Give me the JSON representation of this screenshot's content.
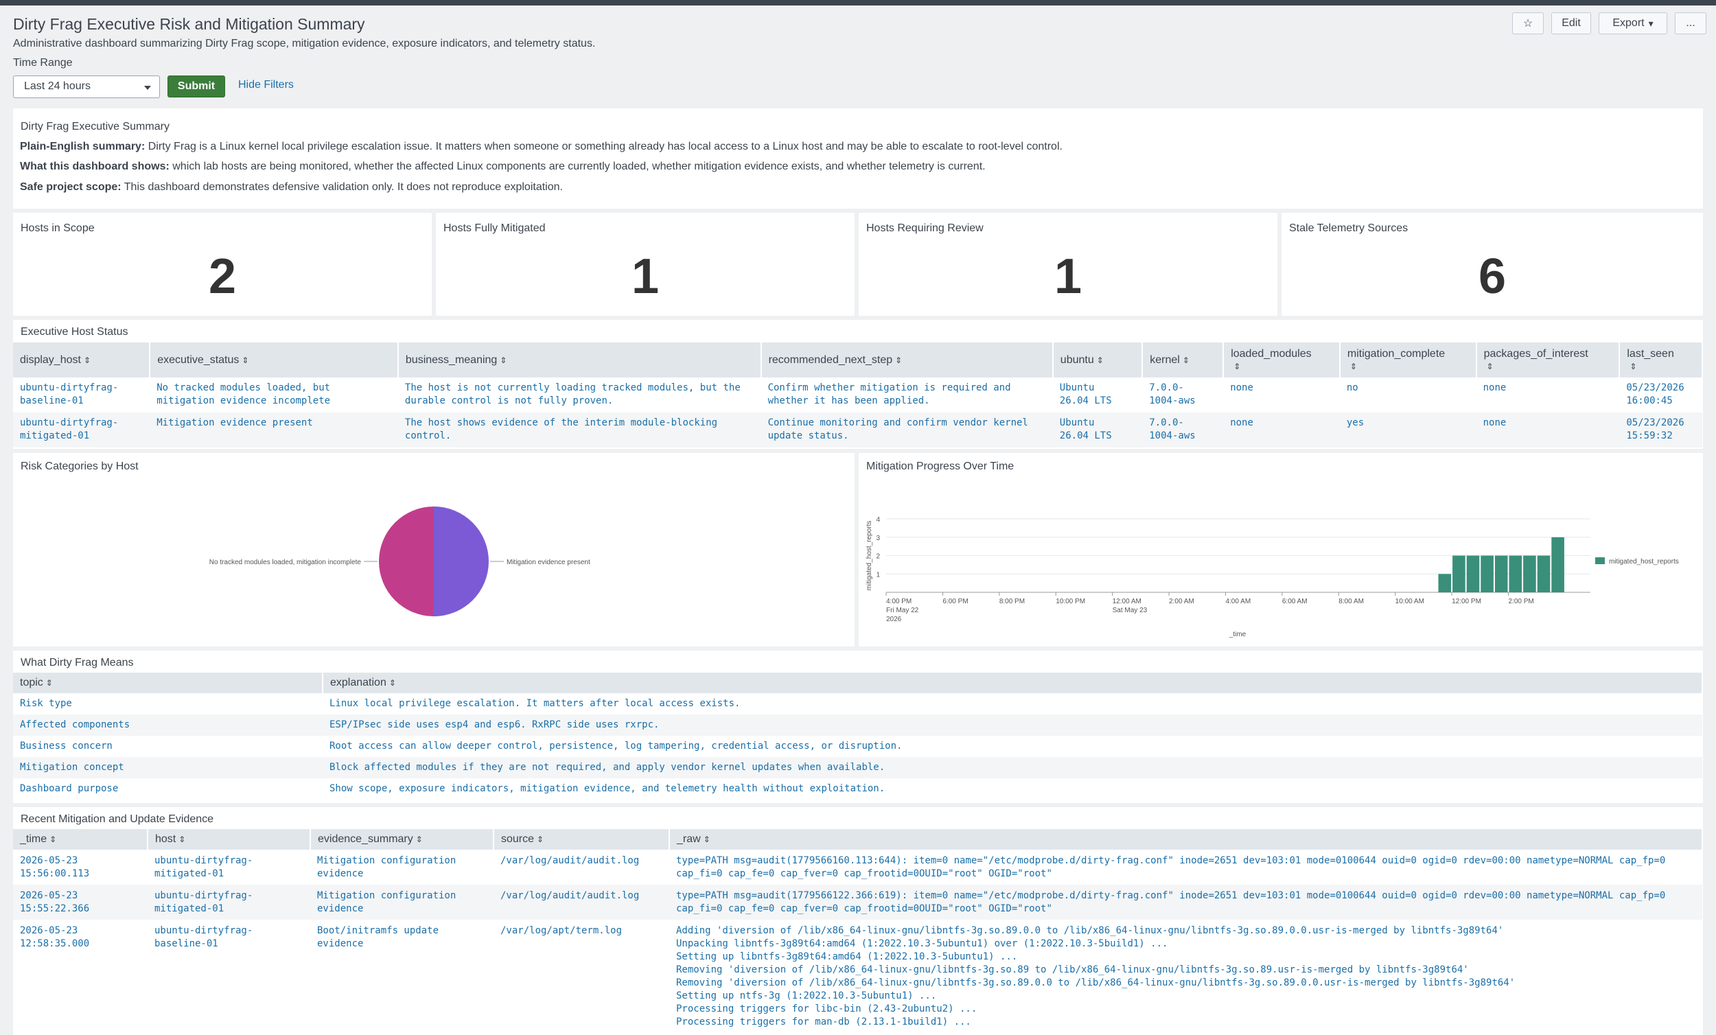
{
  "header": {
    "title": "Dirty Frag Executive Risk and Mitigation Summary",
    "description": "Administrative dashboard summarizing Dirty Frag scope, mitigation evidence, exposure indicators, and telemetry status.",
    "star_icon": "☆",
    "edit_label": "Edit",
    "export_label": "Export",
    "more_label": "..."
  },
  "filters": {
    "time_range_label": "Time Range",
    "time_range_value": "Last 24 hours",
    "submit_label": "Submit",
    "hide_filters_label": "Hide Filters"
  },
  "summary": {
    "title": "Dirty Frag Executive Summary",
    "lines": [
      {
        "bold": "Plain-English summary:",
        "text": " Dirty Frag is a Linux kernel local privilege escalation issue. It matters when someone or something already has local access to a Linux host and may be able to escalate to root-level control."
      },
      {
        "bold": "What this dashboard shows:",
        "text": " which lab hosts are being monitored, whether the affected Linux components are currently loaded, whether mitigation evidence exists, and whether telemetry is current."
      },
      {
        "bold": "Safe project scope:",
        "text": " This dashboard demonstrates defensive validation only. It does not reproduce exploitation."
      }
    ]
  },
  "kpis": [
    {
      "title": "Hosts in Scope",
      "value": "2"
    },
    {
      "title": "Hosts Fully Mitigated",
      "value": "1"
    },
    {
      "title": "Hosts Requiring Review",
      "value": "1"
    },
    {
      "title": "Stale Telemetry Sources",
      "value": "6"
    }
  ],
  "host_status": {
    "title": "Executive Host Status",
    "columns": [
      "display_host",
      "executive_status",
      "business_meaning",
      "recommended_next_step",
      "ubuntu",
      "kernel",
      "loaded_modules",
      "mitigation_complete",
      "packages_of_interest",
      "last_seen"
    ],
    "rows": [
      {
        "display_host": [
          "ubuntu-dirtyfrag-",
          "baseline-01"
        ],
        "executive_status": [
          "No tracked modules loaded, but",
          "mitigation evidence incomplete"
        ],
        "business_meaning": [
          "The host is not currently loading tracked modules, but the",
          "durable control is not fully proven."
        ],
        "recommended_next_step": [
          "Confirm whether mitigation is required and",
          "whether it has been applied."
        ],
        "ubuntu": [
          "Ubuntu",
          "26.04 LTS"
        ],
        "kernel": [
          "7.0.0-",
          "1004-aws"
        ],
        "loaded_modules": [
          "none"
        ],
        "mitigation_complete": [
          "no"
        ],
        "packages_of_interest": [
          "none"
        ],
        "last_seen": [
          "05/23/2026",
          "16:00:45"
        ]
      },
      {
        "display_host": [
          "ubuntu-dirtyfrag-",
          "mitigated-01"
        ],
        "executive_status": [
          "Mitigation evidence present"
        ],
        "business_meaning": [
          "The host shows evidence of the interim module-blocking control."
        ],
        "recommended_next_step": [
          "Continue monitoring and confirm vendor kernel",
          "update status."
        ],
        "ubuntu": [
          "Ubuntu",
          "26.04 LTS"
        ],
        "kernel": [
          "7.0.0-",
          "1004-aws"
        ],
        "loaded_modules": [
          "none"
        ],
        "mitigation_complete": [
          "yes"
        ],
        "packages_of_interest": [
          "none"
        ],
        "last_seen": [
          "05/23/2026",
          "15:59:32"
        ]
      }
    ]
  },
  "risk_categories": {
    "title": "Risk Categories by Host",
    "chart_data": {
      "type": "pie",
      "labels": [
        "No tracked modules loaded, mitigation incomplete",
        "Mitigation evidence present"
      ],
      "values": [
        1,
        1
      ],
      "colors": [
        "#c13d8c",
        "#7c5ad6"
      ]
    }
  },
  "mitigation_progress": {
    "title": "Mitigation Progress Over Time",
    "chart_data": {
      "type": "bar",
      "xlabel": "_time",
      "ylabel": "mitigated_host_reports",
      "ylim": [
        0,
        4
      ],
      "yticks": [
        "1",
        "2",
        "3",
        "4"
      ],
      "xticks": [
        [
          "4:00 PM",
          "Fri May 22",
          "2026"
        ],
        [
          "6:00 PM"
        ],
        [
          "8:00 PM"
        ],
        [
          "10:00 PM"
        ],
        [
          "12:00 AM",
          "Sat May 23"
        ],
        [
          "2:00 AM"
        ],
        [
          "4:00 AM"
        ],
        [
          "6:00 AM"
        ],
        [
          "8:00 AM"
        ],
        [
          "10:00 AM"
        ],
        [
          "12:00 PM"
        ],
        [
          "2:00 PM"
        ]
      ],
      "series": [
        {
          "name": "mitigated_host_reports",
          "color": "#3a8f7a",
          "bars_from_hour_offset": 19.5,
          "values": [
            0,
            0,
            0,
            0,
            0,
            0,
            0,
            0,
            0,
            0,
            0,
            0,
            0,
            0,
            0,
            0,
            0,
            0,
            0,
            0,
            0,
            0,
            0,
            0,
            0,
            0,
            0,
            0,
            0,
            0,
            0,
            0,
            0,
            0,
            0,
            0,
            0,
            0,
            0,
            1,
            2,
            2,
            2,
            2,
            2,
            2,
            2,
            3
          ]
        }
      ],
      "legend": "right"
    }
  },
  "what_means": {
    "title": "What Dirty Frag Means",
    "columns": [
      "topic",
      "explanation"
    ],
    "rows": [
      {
        "topic": "Risk type",
        "explanation": "Linux local privilege escalation. It matters after local access exists."
      },
      {
        "topic": "Affected components",
        "explanation": "ESP/IPsec side uses esp4 and esp6. RxRPC side uses rxrpc."
      },
      {
        "topic": "Business concern",
        "explanation": "Root access can allow deeper control, persistence, log tampering, credential access, or disruption."
      },
      {
        "topic": "Mitigation concept",
        "explanation": "Block affected modules if they are not required, and apply vendor kernel updates when available."
      },
      {
        "topic": "Dashboard purpose",
        "explanation": "Show scope, exposure indicators, mitigation evidence, and telemetry health without exploitation."
      }
    ]
  },
  "evidence": {
    "title": "Recent Mitigation and Update Evidence",
    "columns": [
      "_time",
      "host",
      "evidence_summary",
      "source",
      "_raw"
    ],
    "rows": [
      {
        "time": [
          "2026-05-23",
          "15:56:00.113"
        ],
        "host": [
          "ubuntu-dirtyfrag-",
          "mitigated-01"
        ],
        "summary": [
          "Mitigation configuration",
          "evidence"
        ],
        "source": [
          "/var/log/audit/audit.log"
        ],
        "raw": [
          "type=PATH msg=audit(1779566160.113:644): item=0 name=\"/etc/modprobe.d/dirty-frag.conf\" inode=2651 dev=103:01 mode=0100644 ouid=0 ogid=0 rdev=00:00 nametype=NORMAL cap_fp=0",
          "cap_fi=0 cap_fe=0 cap_fver=0 cap_frootid=0\u001dOUID=\"root\" OGID=\"root\""
        ]
      },
      {
        "time": [
          "2026-05-23",
          "15:55:22.366"
        ],
        "host": [
          "ubuntu-dirtyfrag-",
          "mitigated-01"
        ],
        "summary": [
          "Mitigation configuration",
          "evidence"
        ],
        "source": [
          "/var/log/audit/audit.log"
        ],
        "raw": [
          "type=PATH msg=audit(1779566122.366:619): item=0 name=\"/etc/modprobe.d/dirty-frag.conf\" inode=2651 dev=103:01 mode=0100644 ouid=0 ogid=0 rdev=00:00 nametype=NORMAL cap_fp=0",
          "cap_fi=0 cap_fe=0 cap_fver=0 cap_frootid=0\u001dOUID=\"root\" OGID=\"root\""
        ]
      },
      {
        "time": [
          "2026-05-23",
          "12:58:35.000"
        ],
        "host": [
          "ubuntu-dirtyfrag-",
          "baseline-01"
        ],
        "summary": [
          "Boot/initramfs update",
          "evidence"
        ],
        "source": [
          "/var/log/apt/term.log"
        ],
        "raw": [
          "Adding 'diversion of /lib/x86_64-linux-gnu/libntfs-3g.so.89.0.0 to /lib/x86_64-linux-gnu/libntfs-3g.so.89.0.0.usr-is-merged by libntfs-3g89t64'",
          "Unpacking libntfs-3g89t64:amd64 (1:2022.10.3-5ubuntu1) over (1:2022.10.3-5build1) ...",
          "Setting up libntfs-3g89t64:amd64 (1:2022.10.3-5ubuntu1) ...",
          "Removing 'diversion of /lib/x86_64-linux-gnu/libntfs-3g.so.89 to /lib/x86_64-linux-gnu/libntfs-3g.so.89.usr-is-merged by libntfs-3g89t64'",
          "Removing 'diversion of /lib/x86_64-linux-gnu/libntfs-3g.so.89.0.0 to /lib/x86_64-linux-gnu/libntfs-3g.so.89.0.0.usr-is-merged by libntfs-3g89t64'",
          "Setting up ntfs-3g (1:2022.10.3-5ubuntu1) ...",
          "Processing triggers for libc-bin (2.43-2ubuntu2) ...",
          "Processing triggers for man-db (2.13.1-1build1) ..."
        ]
      }
    ]
  },
  "icons": {
    "sort_icon": "⇕",
    "caret_icon": "▾"
  }
}
